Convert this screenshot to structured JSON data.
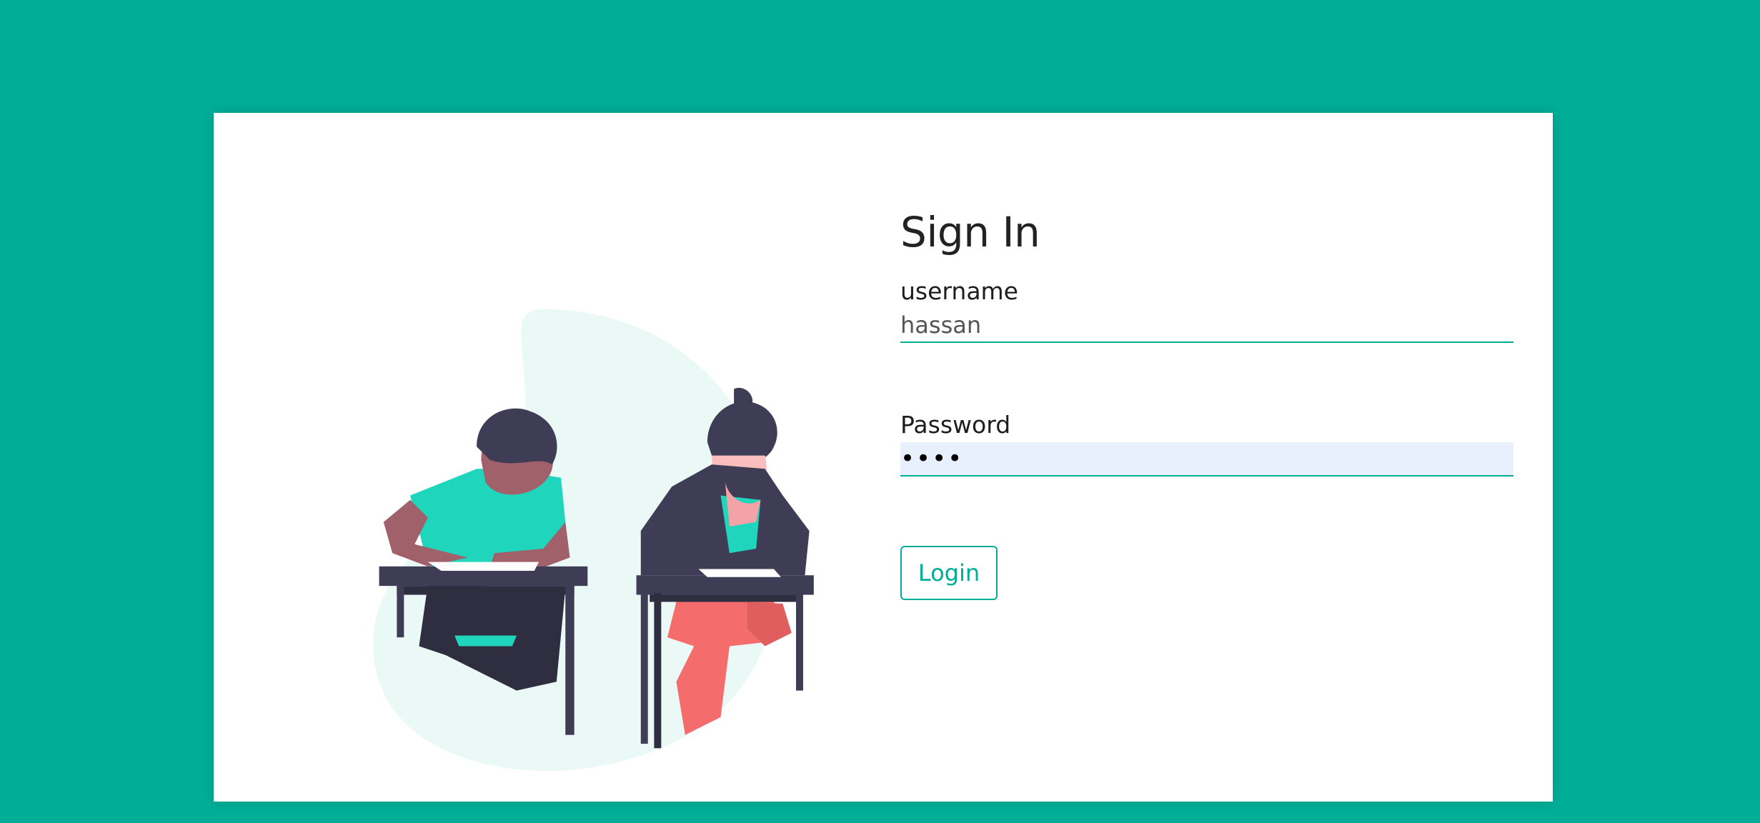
{
  "form": {
    "title": "Sign In",
    "username_label": "username",
    "username_value": "hassan",
    "password_label": "Password",
    "password_value": "hass",
    "login_label": "Login"
  },
  "colors": {
    "background": "#00ad96",
    "accent": "#00ad96",
    "card": "#ffffff",
    "password_fill": "#e8effd"
  }
}
